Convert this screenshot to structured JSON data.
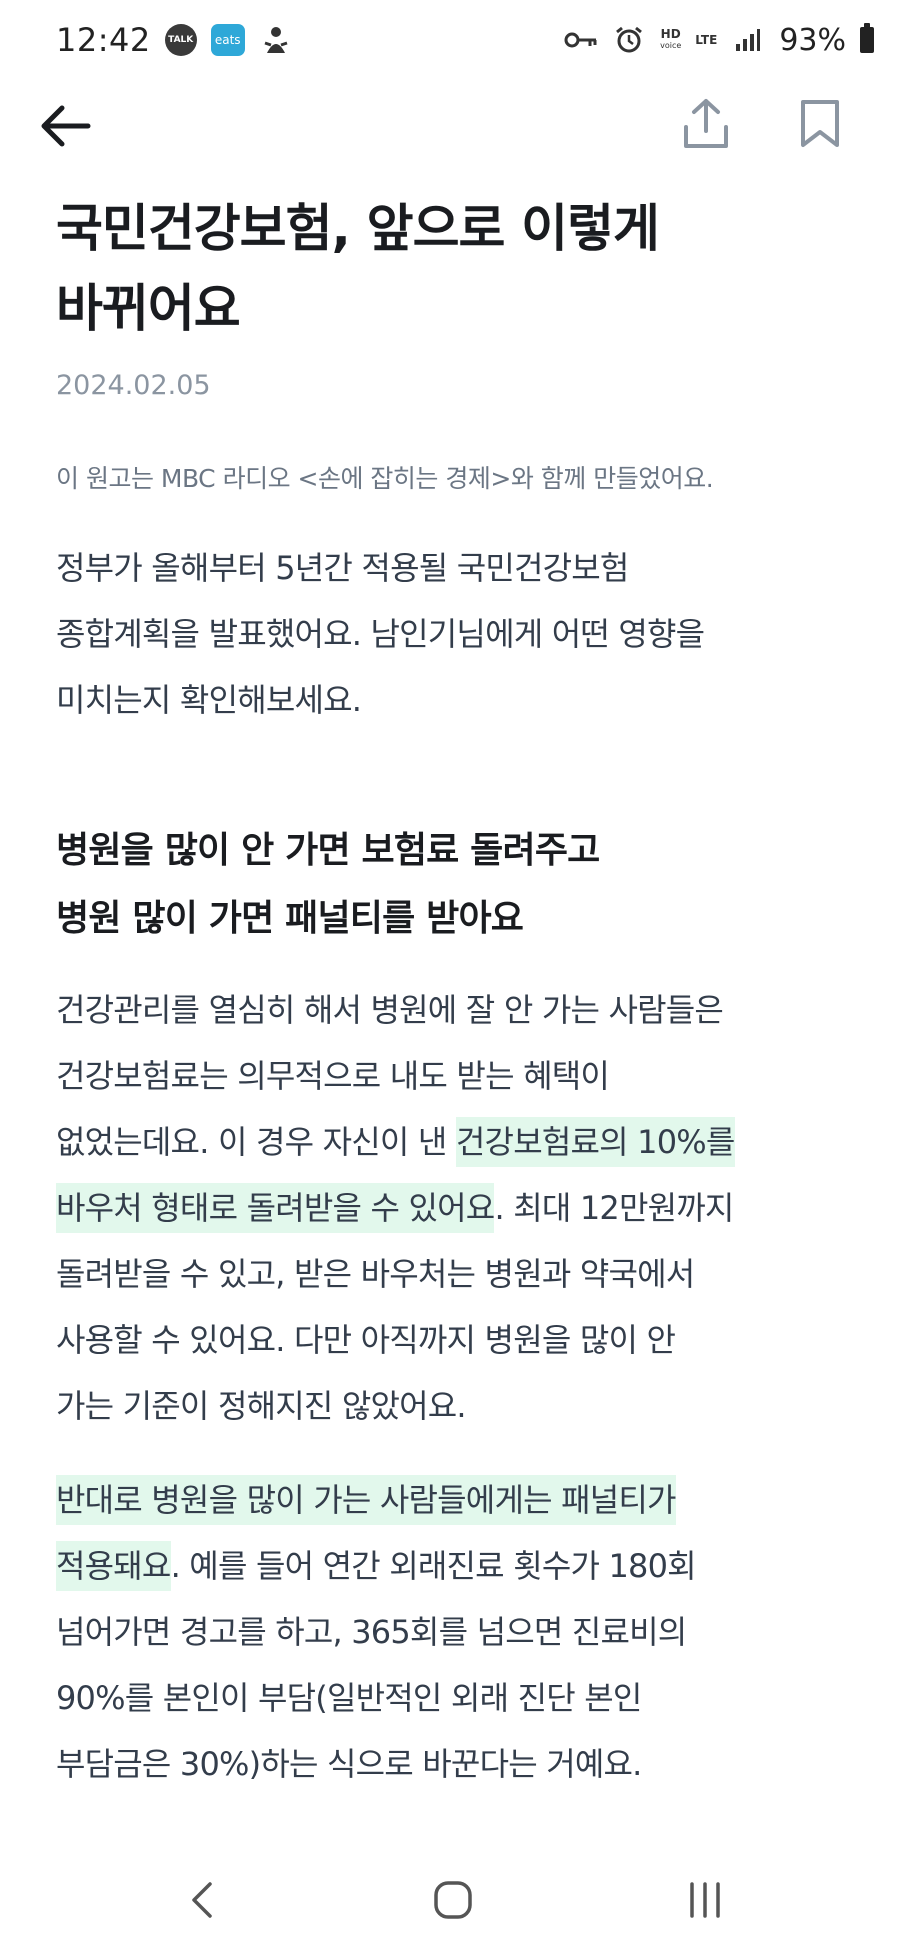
{
  "status_bar": {
    "time": "12:42",
    "app_badges": [
      "TALK",
      "eats"
    ],
    "hd_label": "HD",
    "hd_sub_label": "voice",
    "network_label": "LTE",
    "battery_text": "93%",
    "battery_level_percent": 93
  },
  "article": {
    "title_line1": "국민건강보험, 앞으로 이렇게",
    "title_line2": "바뀌어요",
    "date": "2024.02.05",
    "note": "이 원고는 MBC 라디오 <손에 잡히는 경제>와 함께 만들었어요.",
    "intro": {
      "lines": [
        "정부가 올해부터 5년간 적용될 국민건강보험",
        "종합계획을 발표했어요. 남인기님에게 어떤 영향을",
        "미치는지 확인해보세요."
      ]
    },
    "section1": {
      "heading_line1": "병원을 많이 안 가면 보험료 돌려주고",
      "heading_line2": "병원 많이 가면 패널티를 받아요",
      "para1": {
        "line1": "건강관리를 열심히 해서 병원에 잘 안 가는 사람들은",
        "line2": "건강보험료는 의무적으로 내도 받는 혜택이",
        "line3_plain": "없었는데요. 이 경우 자신이 낸 ",
        "line3_highlight": "건강보험료의 10%를",
        "line4_highlight": "바우처 형태로 돌려받을 수 있어요",
        "line4_plain": ". 최대 12만원까지",
        "line5": "돌려받을 수 있고, 받은 바우처는 병원과 약국에서",
        "line6": "사용할 수 있어요. 다만 아직까지 병원을 많이 안",
        "line7": "가는 기준이 정해지진 않았어요."
      },
      "para2": {
        "line1_highlight": "반대로 병원을 많이 가는 사람들에게는 패널티가",
        "line2_highlight": "적용돼요",
        "line2_plain": ". 예를 들어 연간 외래진료 횟수가 180회",
        "line3": "넘어가면 경고를 하고, 365회를 넘으면 진료비의",
        "line4": "90%를 본인이 부담(일반적인 외래 진단 본인",
        "line5": "부담금은 30%)하는 식으로 바꾼다는 거예요."
      }
    }
  },
  "colors": {
    "highlight": "#e2f8ec",
    "date_gray": "#8b95a1",
    "body_text": "#333d4b",
    "title_text": "#1a1c20"
  },
  "icons": {
    "top_nav": [
      "back-arrow-icon",
      "share-icon",
      "bookmark-icon"
    ],
    "system_nav": [
      "chevron-left-icon",
      "home-icon",
      "recents-icon"
    ]
  }
}
